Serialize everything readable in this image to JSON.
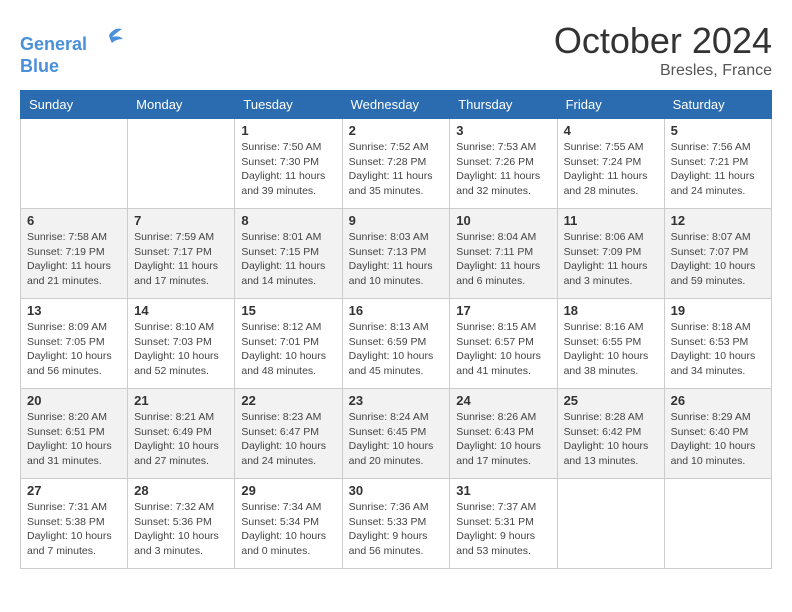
{
  "header": {
    "logo_line1": "General",
    "logo_line2": "Blue",
    "month_title": "October 2024",
    "location": "Bresles, France"
  },
  "days_of_week": [
    "Sunday",
    "Monday",
    "Tuesday",
    "Wednesday",
    "Thursday",
    "Friday",
    "Saturday"
  ],
  "weeks": [
    [
      {
        "day": "",
        "info": ""
      },
      {
        "day": "",
        "info": ""
      },
      {
        "day": "1",
        "info": "Sunrise: 7:50 AM\nSunset: 7:30 PM\nDaylight: 11 hours and 39 minutes."
      },
      {
        "day": "2",
        "info": "Sunrise: 7:52 AM\nSunset: 7:28 PM\nDaylight: 11 hours and 35 minutes."
      },
      {
        "day": "3",
        "info": "Sunrise: 7:53 AM\nSunset: 7:26 PM\nDaylight: 11 hours and 32 minutes."
      },
      {
        "day": "4",
        "info": "Sunrise: 7:55 AM\nSunset: 7:24 PM\nDaylight: 11 hours and 28 minutes."
      },
      {
        "day": "5",
        "info": "Sunrise: 7:56 AM\nSunset: 7:21 PM\nDaylight: 11 hours and 24 minutes."
      }
    ],
    [
      {
        "day": "6",
        "info": "Sunrise: 7:58 AM\nSunset: 7:19 PM\nDaylight: 11 hours and 21 minutes."
      },
      {
        "day": "7",
        "info": "Sunrise: 7:59 AM\nSunset: 7:17 PM\nDaylight: 11 hours and 17 minutes."
      },
      {
        "day": "8",
        "info": "Sunrise: 8:01 AM\nSunset: 7:15 PM\nDaylight: 11 hours and 14 minutes."
      },
      {
        "day": "9",
        "info": "Sunrise: 8:03 AM\nSunset: 7:13 PM\nDaylight: 11 hours and 10 minutes."
      },
      {
        "day": "10",
        "info": "Sunrise: 8:04 AM\nSunset: 7:11 PM\nDaylight: 11 hours and 6 minutes."
      },
      {
        "day": "11",
        "info": "Sunrise: 8:06 AM\nSunset: 7:09 PM\nDaylight: 11 hours and 3 minutes."
      },
      {
        "day": "12",
        "info": "Sunrise: 8:07 AM\nSunset: 7:07 PM\nDaylight: 10 hours and 59 minutes."
      }
    ],
    [
      {
        "day": "13",
        "info": "Sunrise: 8:09 AM\nSunset: 7:05 PM\nDaylight: 10 hours and 56 minutes."
      },
      {
        "day": "14",
        "info": "Sunrise: 8:10 AM\nSunset: 7:03 PM\nDaylight: 10 hours and 52 minutes."
      },
      {
        "day": "15",
        "info": "Sunrise: 8:12 AM\nSunset: 7:01 PM\nDaylight: 10 hours and 48 minutes."
      },
      {
        "day": "16",
        "info": "Sunrise: 8:13 AM\nSunset: 6:59 PM\nDaylight: 10 hours and 45 minutes."
      },
      {
        "day": "17",
        "info": "Sunrise: 8:15 AM\nSunset: 6:57 PM\nDaylight: 10 hours and 41 minutes."
      },
      {
        "day": "18",
        "info": "Sunrise: 8:16 AM\nSunset: 6:55 PM\nDaylight: 10 hours and 38 minutes."
      },
      {
        "day": "19",
        "info": "Sunrise: 8:18 AM\nSunset: 6:53 PM\nDaylight: 10 hours and 34 minutes."
      }
    ],
    [
      {
        "day": "20",
        "info": "Sunrise: 8:20 AM\nSunset: 6:51 PM\nDaylight: 10 hours and 31 minutes."
      },
      {
        "day": "21",
        "info": "Sunrise: 8:21 AM\nSunset: 6:49 PM\nDaylight: 10 hours and 27 minutes."
      },
      {
        "day": "22",
        "info": "Sunrise: 8:23 AM\nSunset: 6:47 PM\nDaylight: 10 hours and 24 minutes."
      },
      {
        "day": "23",
        "info": "Sunrise: 8:24 AM\nSunset: 6:45 PM\nDaylight: 10 hours and 20 minutes."
      },
      {
        "day": "24",
        "info": "Sunrise: 8:26 AM\nSunset: 6:43 PM\nDaylight: 10 hours and 17 minutes."
      },
      {
        "day": "25",
        "info": "Sunrise: 8:28 AM\nSunset: 6:42 PM\nDaylight: 10 hours and 13 minutes."
      },
      {
        "day": "26",
        "info": "Sunrise: 8:29 AM\nSunset: 6:40 PM\nDaylight: 10 hours and 10 minutes."
      }
    ],
    [
      {
        "day": "27",
        "info": "Sunrise: 7:31 AM\nSunset: 5:38 PM\nDaylight: 10 hours and 7 minutes."
      },
      {
        "day": "28",
        "info": "Sunrise: 7:32 AM\nSunset: 5:36 PM\nDaylight: 10 hours and 3 minutes."
      },
      {
        "day": "29",
        "info": "Sunrise: 7:34 AM\nSunset: 5:34 PM\nDaylight: 10 hours and 0 minutes."
      },
      {
        "day": "30",
        "info": "Sunrise: 7:36 AM\nSunset: 5:33 PM\nDaylight: 9 hours and 56 minutes."
      },
      {
        "day": "31",
        "info": "Sunrise: 7:37 AM\nSunset: 5:31 PM\nDaylight: 9 hours and 53 minutes."
      },
      {
        "day": "",
        "info": ""
      },
      {
        "day": "",
        "info": ""
      }
    ]
  ]
}
